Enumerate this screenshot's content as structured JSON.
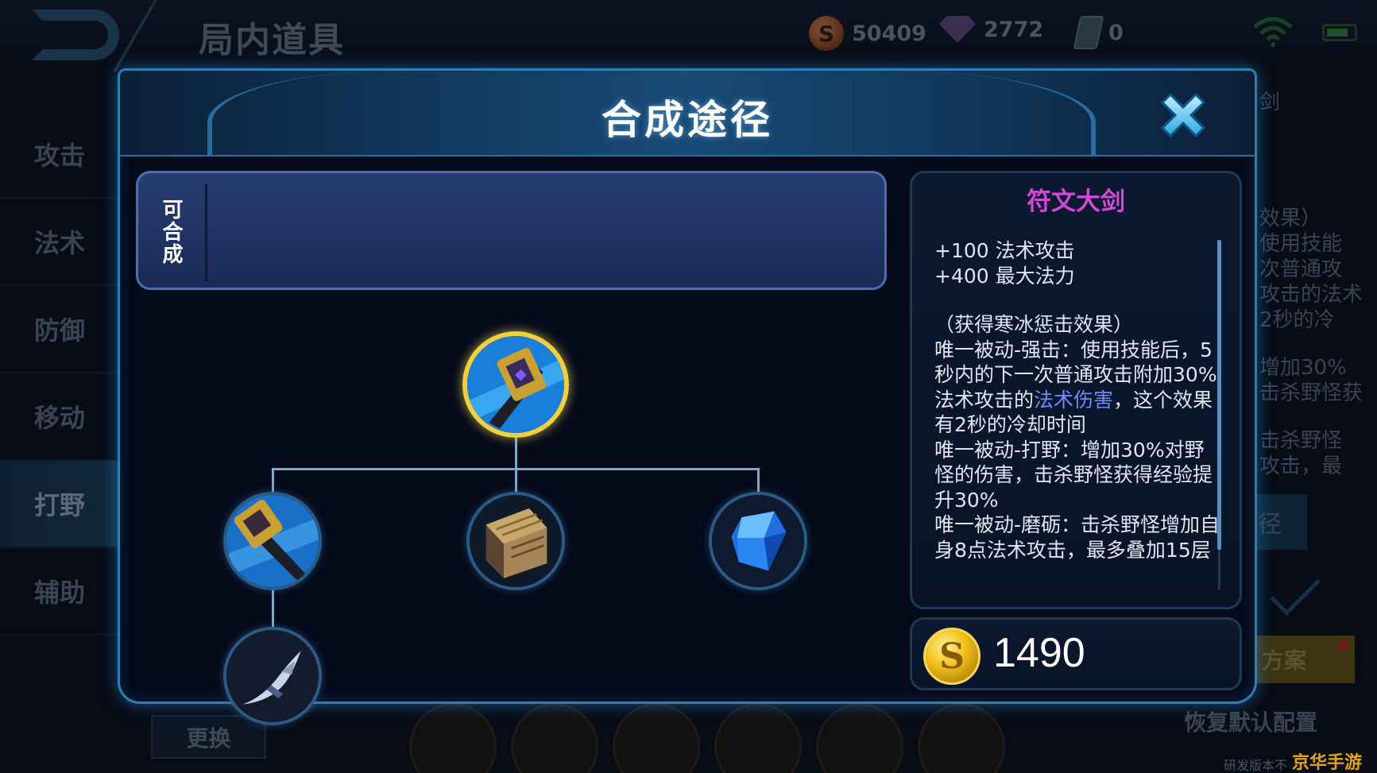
{
  "background": {
    "page_title": "局内道具",
    "resources": {
      "gold": "50409",
      "gems": "2772",
      "tickets": "0"
    },
    "categories": [
      {
        "label": "攻击"
      },
      {
        "label": "法术"
      },
      {
        "label": "防御"
      },
      {
        "label": "移动"
      },
      {
        "label": "打野",
        "active": true
      },
      {
        "label": "辅助"
      }
    ],
    "right_text_fragments": [
      "剑",
      "效果）",
      "使用技能",
      "次普通攻",
      "攻击的法术",
      "2秒的冷",
      "增加30%",
      "击杀野怪获",
      "击杀野怪",
      "攻击，最"
    ],
    "right_button_fragment": "径",
    "plan_button_fragment": "方案",
    "restore_label": "恢复默认配置",
    "swap_label": "更换",
    "dev_note": "研发版本不代表最终品质",
    "watermark": "京华手游网"
  },
  "modal": {
    "title": "合成途径",
    "craftable_label": "可合成",
    "tree": {
      "target": "rune-greatsword-icon",
      "components": [
        "hunter-blade-icon",
        "magic-book-icon",
        "blue-crystal-icon"
      ],
      "sub_components": [
        "hunting-knife-icon"
      ]
    },
    "item": {
      "name": "符文大剑",
      "name_color": "#d04ad8",
      "stats": [
        "+100 法术攻击",
        "+400 最大法力"
      ],
      "desc_line1": "（获得寒冰惩击效果）",
      "desc_passive1_a": "唯一被动-强击：使用技能后，5秒内的下一次普通攻击附加30%法术攻击的",
      "desc_passive1_hl": "法术伤害",
      "desc_passive1_b": "，这个效果有2秒的冷却时间",
      "desc_passive2": "唯一被动-打野：增加30%对野怪的伤害，击杀野怪获得经验提升30%",
      "desc_passive3": "唯一被动-磨砺：击杀野怪增加自身8点法术攻击，最多叠加15层"
    },
    "price": "1490"
  }
}
